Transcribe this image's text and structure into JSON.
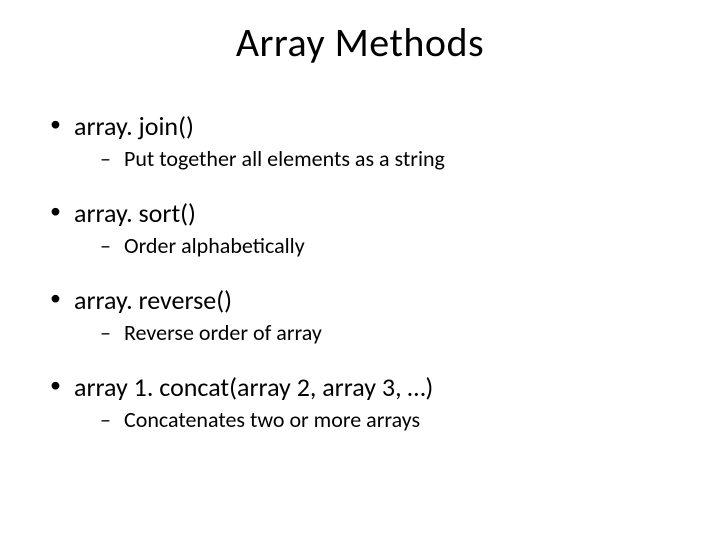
{
  "title": "Array Methods",
  "items": [
    {
      "method": "array. join()",
      "desc": "Put together all elements as a string"
    },
    {
      "method": "array. sort()",
      "desc": "Order alphabetically"
    },
    {
      "method": "array. reverse()",
      "desc": "Reverse order of array"
    },
    {
      "method": "array 1. concat(array 2, array 3, …)",
      "desc": "Concatenates two or more arrays"
    }
  ]
}
